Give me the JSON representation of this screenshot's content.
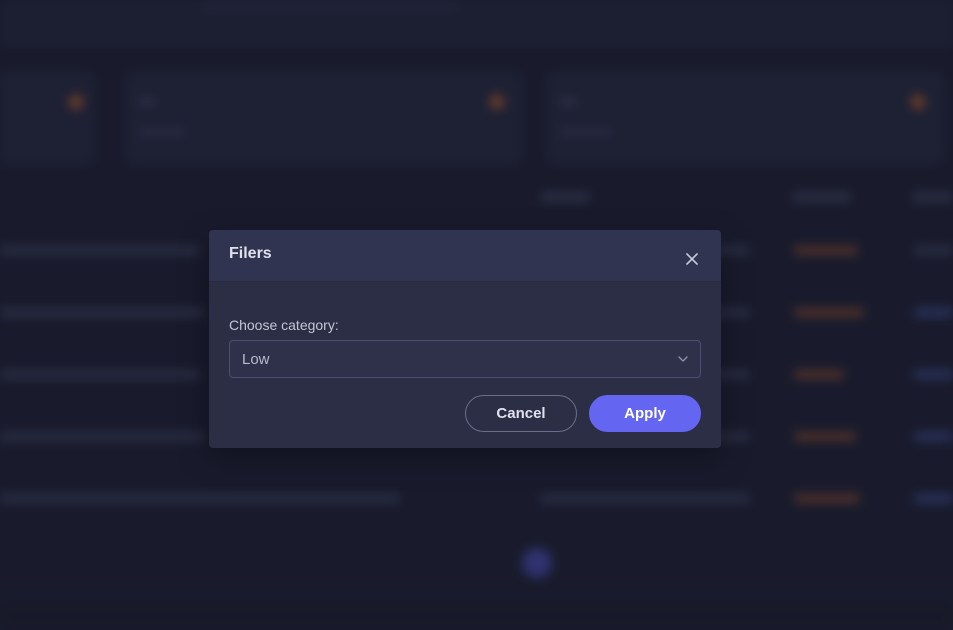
{
  "modal": {
    "title": "Filers",
    "field_label": "Choose category:",
    "selected_category": "Low",
    "cancel_label": "Cancel",
    "apply_label": "Apply",
    "close_icon": "close-icon",
    "chevron_icon": "chevron-down-icon"
  },
  "colors": {
    "background": "#1e2033",
    "modal_bg": "#2b2e45",
    "modal_header_bg": "#313450",
    "accent": "#6466f1",
    "highlight_orange": "#e0742e"
  }
}
